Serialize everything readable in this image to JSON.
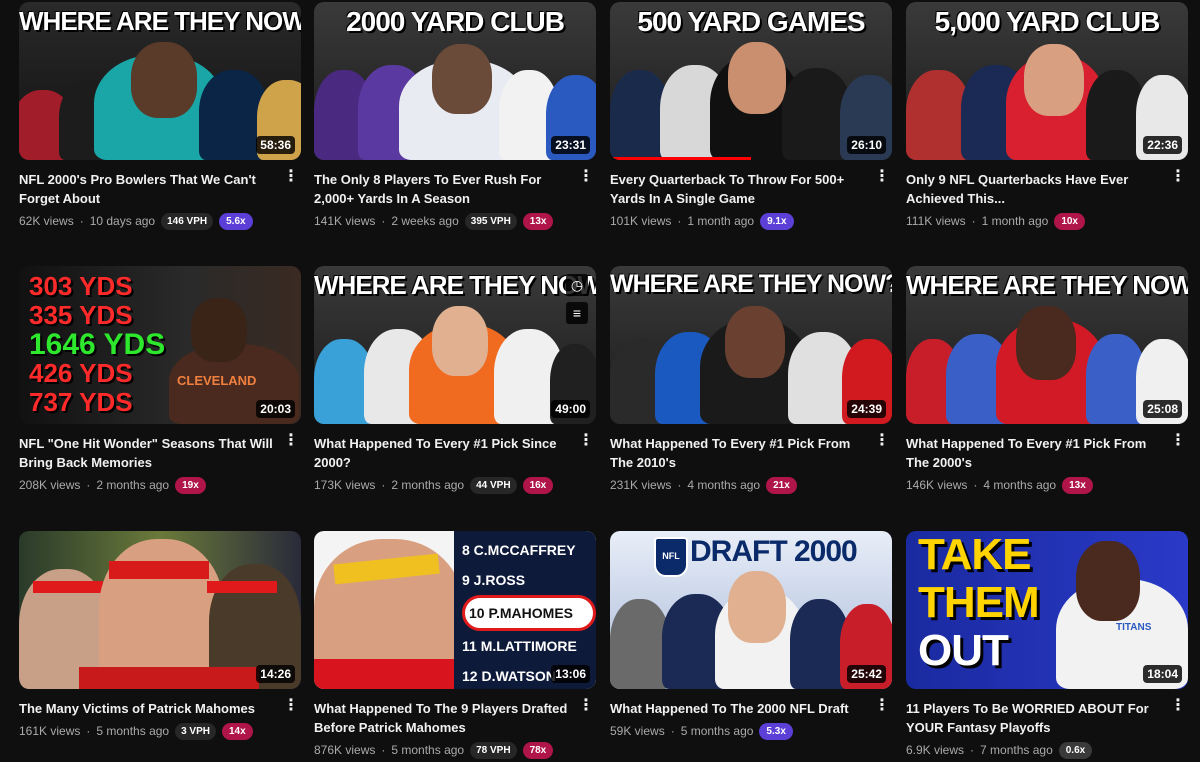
{
  "videos": [
    {
      "title": "NFL 2000's Pro Bowlers That We Can't Forget About",
      "views": "62K views",
      "age": "10 days ago",
      "vph": "146 VPH",
      "mult": "5.6x",
      "mult_color": "purple",
      "duration": "58:36",
      "thumb_text": "WHERE ARE THEY NOW?"
    },
    {
      "title": "The Only 8 Players To Ever Rush For 2,000+ Yards In A Season",
      "views": "141K views",
      "age": "2 weeks ago",
      "vph": "395 VPH",
      "mult": "13x",
      "mult_color": "red",
      "duration": "23:31",
      "thumb_text": "2000 YARD CLUB"
    },
    {
      "title": "Every Quarterback To Throw For 500+ Yards In A Single Game",
      "views": "101K views",
      "age": "1 month ago",
      "vph": "",
      "mult": "9.1x",
      "mult_color": "purple",
      "duration": "26:10",
      "thumb_text": "500 YARD GAMES",
      "progress": 0.5
    },
    {
      "title": "Only 9 NFL Quarterbacks Have Ever Achieved This...",
      "views": "111K views",
      "age": "1 month ago",
      "vph": "",
      "mult": "10x",
      "mult_color": "red",
      "duration": "22:36",
      "thumb_text": "5,000 YARD CLUB"
    },
    {
      "title": "NFL \"One Hit Wonder\" Seasons That Will Bring Back Memories",
      "views": "208K views",
      "age": "2 months ago",
      "vph": "",
      "mult": "19x",
      "mult_color": "red",
      "duration": "20:03",
      "thumb_lines": [
        "303 YDS",
        "335 YDS",
        "1646 YDS",
        "426 YDS",
        "737 YDS"
      ],
      "thumb_text2": "CLEVELAND"
    },
    {
      "title": "What Happened To Every #1 Pick Since 2000?",
      "views": "173K views",
      "age": "2 months ago",
      "vph": "44 VPH",
      "mult": "16x",
      "mult_color": "red",
      "duration": "49:00",
      "thumb_text": "WHERE ARE THEY NOW"
    },
    {
      "title": "What Happened To Every #1 Pick From The 2010's",
      "views": "231K views",
      "age": "4 months ago",
      "vph": "",
      "mult": "21x",
      "mult_color": "red",
      "duration": "24:39",
      "thumb_text": "WHERE ARE THEY NOW?"
    },
    {
      "title": "What Happened To Every #1 Pick From The 2000's",
      "views": "146K views",
      "age": "4 months ago",
      "vph": "",
      "mult": "13x",
      "mult_color": "red",
      "duration": "25:08",
      "thumb_text": "WHERE ARE THEY NOW"
    },
    {
      "title": "The Many Victims of Patrick Mahomes",
      "views": "161K views",
      "age": "5 months ago",
      "vph": "3 VPH",
      "mult": "14x",
      "mult_color": "red",
      "duration": "14:26",
      "thumb_text": ""
    },
    {
      "title": "What Happened To The 9 Players Drafted Before Patrick Mahomes",
      "views": "876K views",
      "age": "5 months ago",
      "vph": "78 VPH",
      "mult": "78x",
      "mult_color": "red",
      "duration": "13:06",
      "thumb_lines": [
        "8 C.MCCAFFREY",
        "9 J.ROSS",
        "10 P.MAHOMES",
        "11 M.LATTIMORE",
        "12 D.WATSON"
      ]
    },
    {
      "title": "What Happened To The 2000 NFL Draft",
      "views": "59K views",
      "age": "5 months ago",
      "vph": "",
      "mult": "5.3x",
      "mult_color": "purple",
      "duration": "25:42",
      "thumb_text": "DRAFT 2000",
      "thumb_logo": "NFL"
    },
    {
      "title": "11 Players To Be WORRIED ABOUT For YOUR Fantasy Playoffs",
      "views": "6.9K views",
      "age": "7 months ago",
      "vph": "",
      "mult": "0.6x",
      "mult_color": "grey",
      "duration": "18:04",
      "thumb_lines": [
        "TAKE",
        "THEM",
        "OUT"
      ],
      "thumb_text2": "TITANS"
    }
  ],
  "icons": {
    "kebab": "more-vert-icon",
    "watch_later": "clock-icon",
    "queue": "add-to-queue-icon"
  }
}
